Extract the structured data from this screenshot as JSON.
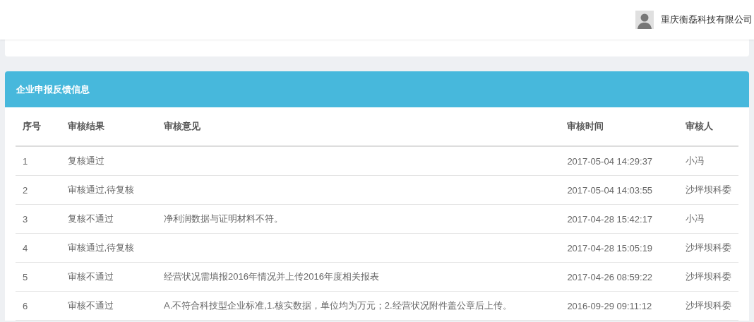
{
  "header": {
    "company": "重庆衡磊科技有限公司"
  },
  "panel": {
    "title": "企业申报反馈信息"
  },
  "table": {
    "columns": [
      "序号",
      "审核结果",
      "审核意见",
      "审核时间",
      "审核人"
    ],
    "rows": [
      [
        "1",
        "复核通过",
        "",
        "2017-05-04 14:29:37",
        "小冯"
      ],
      [
        "2",
        "审核通过,待复核",
        "",
        "2017-05-04 14:03:55",
        "沙坪坝科委"
      ],
      [
        "3",
        "复核不通过",
        "净利润数据与证明材料不符。",
        "2017-04-28 15:42:17",
        "小冯"
      ],
      [
        "4",
        "审核通过,待复核",
        "",
        "2017-04-28 15:05:19",
        "沙坪坝科委"
      ],
      [
        "5",
        "审核不通过",
        "经营状况需填报2016年情况并上传2016年度相关报表",
        "2017-04-26 08:59:22",
        "沙坪坝科委"
      ],
      [
        "6",
        "审核不通过",
        "A.不符合科技型企业标准,1.核实数据，单位均为万元；2.经营状况附件盖公章后上传。",
        "2016-09-29 09:11:12",
        "沙坪坝科委"
      ]
    ]
  }
}
